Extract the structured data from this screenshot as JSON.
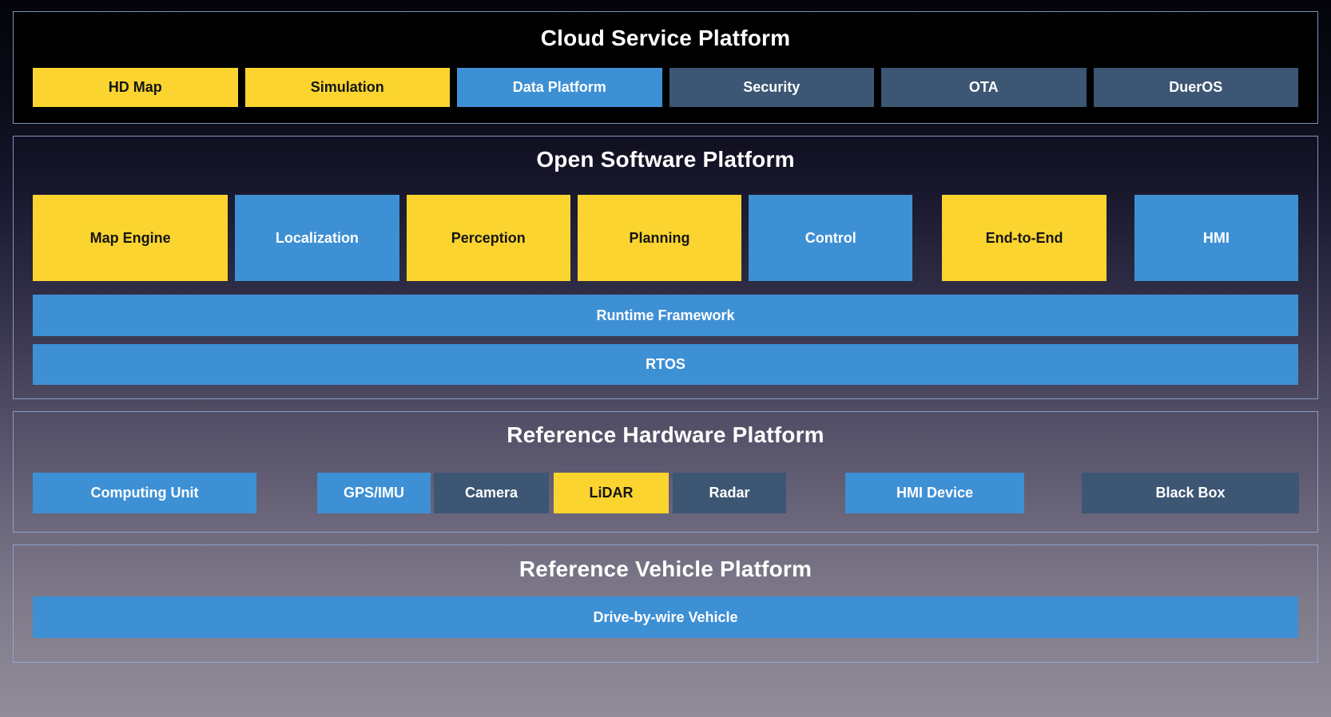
{
  "colors": {
    "yellow_box": "#FBD42F",
    "blue_box": "#3E90D5",
    "slate_box": "#3C5674",
    "title_text": "#FFFFFF",
    "cloud_background": "#000000"
  },
  "cloud": {
    "title": "Cloud Service Platform",
    "items": [
      {
        "label": "HD Map",
        "variant": "yellow"
      },
      {
        "label": "Simulation",
        "variant": "yellow"
      },
      {
        "label": "Data Platform",
        "variant": "blue"
      },
      {
        "label": "Security",
        "variant": "slate"
      },
      {
        "label": "OTA",
        "variant": "slate"
      },
      {
        "label": "DuerOS",
        "variant": "slate"
      }
    ]
  },
  "software": {
    "title": "Open Software Platform",
    "modules": [
      {
        "label": "Map Engine",
        "variant": "yellow"
      },
      {
        "label": "Localization",
        "variant": "blue"
      },
      {
        "label": "Perception",
        "variant": "yellow"
      },
      {
        "label": "Planning",
        "variant": "yellow"
      },
      {
        "label": "Control",
        "variant": "blue"
      },
      {
        "label": "End-to-End",
        "variant": "yellow"
      },
      {
        "label": "HMI",
        "variant": "blue"
      }
    ],
    "bars": [
      {
        "label": "Runtime Framework",
        "variant": "blue"
      },
      {
        "label": "RTOS",
        "variant": "blue"
      }
    ]
  },
  "hardware": {
    "title": "Reference Hardware Platform",
    "items": [
      {
        "label": "Computing Unit",
        "variant": "blue"
      },
      {
        "label": "GPS/IMU",
        "variant": "blue"
      },
      {
        "label": "Camera",
        "variant": "slate"
      },
      {
        "label": "LiDAR",
        "variant": "yellow"
      },
      {
        "label": "Radar",
        "variant": "slate"
      },
      {
        "label": "HMI Device",
        "variant": "blue"
      },
      {
        "label": "Black Box",
        "variant": "slate"
      }
    ]
  },
  "vehicle": {
    "title": "Reference Vehicle Platform",
    "bar": {
      "label": "Drive-by-wire Vehicle",
      "variant": "blue"
    }
  }
}
